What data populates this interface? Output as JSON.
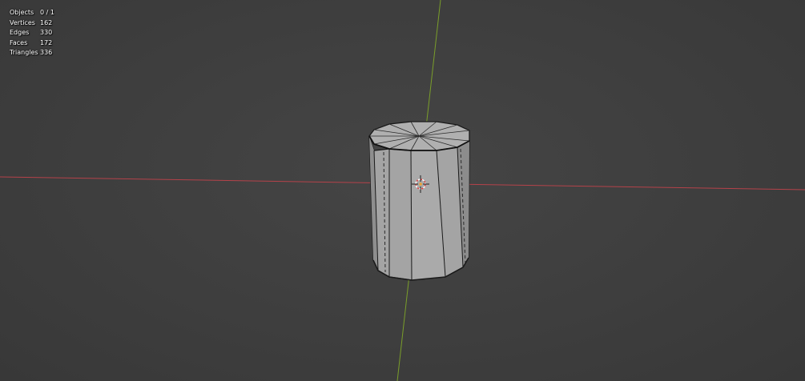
{
  "statistics": {
    "rows": [
      {
        "label": "Objects",
        "value": "0 / 1"
      },
      {
        "label": "Vertices",
        "value": "162"
      },
      {
        "label": "Edges",
        "value": "330"
      },
      {
        "label": "Faces",
        "value": "172"
      },
      {
        "label": "Triangles",
        "value": "336"
      }
    ]
  },
  "colors": {
    "background": "#3d3d3d",
    "x_axis": "#b5424a",
    "y_axis": "#7a9e2a",
    "mesh_face": "#a3a3a3",
    "mesh_edge": "#1a1a1a",
    "cursor_outer": "#e04040",
    "cursor_inner": "#ffffff",
    "origin": "#f0a030"
  }
}
